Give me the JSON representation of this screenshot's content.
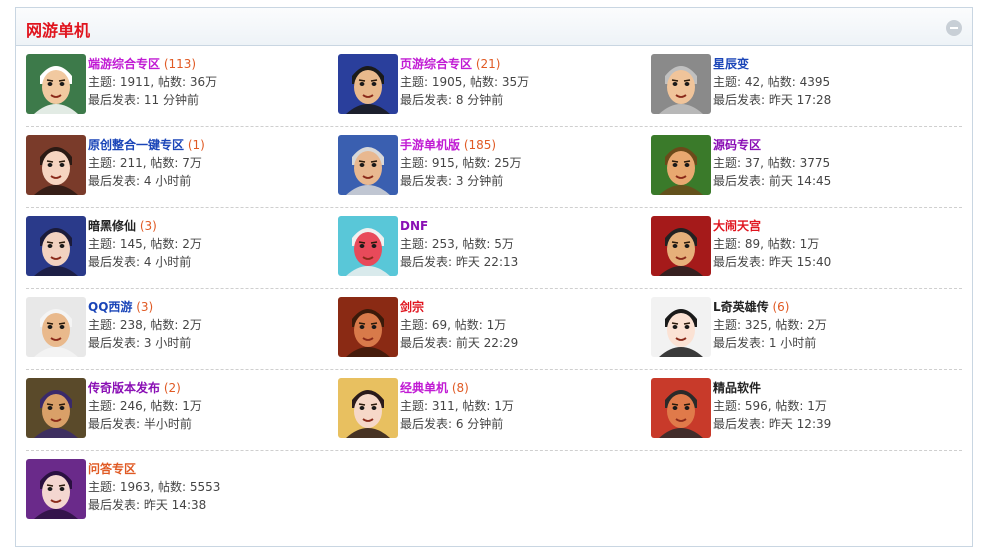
{
  "panel": {
    "title": "网游单机"
  },
  "labels": {
    "topics": "主题",
    "posts": "帖数",
    "last_post": "最后发表"
  },
  "forums": [
    {
      "name": "端游综合专区",
      "count": "(113)",
      "stats": "主题: 1911, 帖数: 36万",
      "last": "最后发表: 11 分钟前",
      "name_color": "#c11bd4",
      "avatar": "old-sage-avatar",
      "bg": "#3d7a4a",
      "face": "#f1c9a0",
      "hair": "#ffffff"
    },
    {
      "name": "页游综合专区",
      "count": "(21)",
      "stats": "主题: 1905, 帖数: 35万",
      "last": "最后发表: 8 分钟前",
      "name_color": "#c11bd4",
      "avatar": "warrior-hat-avatar",
      "bg": "#2a3f9c",
      "face": "#e9b98c",
      "hair": "#1a1a1a"
    },
    {
      "name": "星辰变",
      "count": "",
      "stats": "主题: 42, 帖数: 4395",
      "last": "最后发表: 昨天 17:28",
      "name_color": "#1a45b8",
      "avatar": "helmet-warrior-avatar",
      "bg": "#8a8a8a",
      "face": "#f0c49a",
      "hair": "#c0c0c0"
    },
    {
      "name": "原创整合一键专区",
      "count": "(1)",
      "stats": "主题: 211, 帖数: 7万",
      "last": "最后发表: 4 小时前",
      "name_color": "#1a45b8",
      "avatar": "princess-avatar",
      "bg": "#7a3b2a",
      "face": "#f6d5c1",
      "hair": "#2a1a14"
    },
    {
      "name": "手游单机版",
      "count": "(185)",
      "stats": "主题: 915, 帖数: 25万",
      "last": "最后发表: 3 分钟前",
      "name_color": "#c11bd4",
      "avatar": "granny-avatar",
      "bg": "#3a5fb0",
      "face": "#e8b890",
      "hair": "#d8d8d8"
    },
    {
      "name": "源码专区",
      "count": "",
      "stats": "主题: 37, 帖数: 3775",
      "last": "最后发表: 前天 14:45",
      "name_color": "#8a0fb5",
      "avatar": "monkey-king-avatar",
      "bg": "#3a7a2a",
      "face": "#e8a870",
      "hair": "#6b4a1a"
    },
    {
      "name": "暗黑修仙",
      "count": "(3)",
      "stats": "主题: 145, 帖数: 2万",
      "last": "最后发表: 4 小时前",
      "name_color": "#222222",
      "avatar": "dark-fairy-avatar",
      "bg": "#2a3a8a",
      "face": "#f2d2c0",
      "hair": "#1b1b3a"
    },
    {
      "name": "DNF",
      "count": "",
      "stats": "主题: 253, 帖数: 5万",
      "last": "最后发表: 昨天 22:13",
      "name_color": "#8a0fb5",
      "avatar": "masked-ninja-avatar",
      "bg": "#59c7d8",
      "face": "#e84a5a",
      "hair": "#f0f0f0"
    },
    {
      "name": "大闹天宫",
      "count": "",
      "stats": "主题: 89, 帖数: 1万",
      "last": "最后发表: 昨天 15:40",
      "name_color": "#e0141e",
      "avatar": "horned-demon-avatar",
      "bg": "#a51a1a",
      "face": "#e6b07a",
      "hair": "#222222"
    },
    {
      "name": "QQ西游",
      "count": "(3)",
      "stats": "主题: 238, 帖数: 2万",
      "last": "最后发表: 3 小时前",
      "name_color": "#1a45b8",
      "avatar": "old-master-avatar",
      "bg": "#e8e8e8",
      "face": "#e9b98c",
      "hair": "#f4f4f4"
    },
    {
      "name": "剑宗",
      "count": "",
      "stats": "主题: 69, 帖数: 1万",
      "last": "最后发表: 前天 22:29",
      "name_color": "#e0141e",
      "avatar": "bald-brute-avatar",
      "bg": "#8a2a14",
      "face": "#d87a4a",
      "hair": "#3a1a0a"
    },
    {
      "name": "L奇英雄传",
      "count": "(6)",
      "stats": "主题: 325, 帖数: 2万",
      "last": "最后发表: 1 小时前",
      "name_color": "#222222",
      "avatar": "opera-lady-avatar",
      "bg": "#f2f2f2",
      "face": "#fbe2d4",
      "hair": "#1a1a1a"
    },
    {
      "name": "传奇版本发布",
      "count": "(2)",
      "stats": "主题: 246, 帖数: 1万",
      "last": "最后发表: 半小时前",
      "name_color": "#8a0fb5",
      "avatar": "grinning-villain-avatar",
      "bg": "#5a4a2a",
      "face": "#d9a068",
      "hair": "#3a2a6a"
    },
    {
      "name": "经典单机",
      "count": "(8)",
      "stats": "主题: 311, 帖数: 1万",
      "last": "最后发表: 6 分钟前",
      "name_color": "#c11bd4",
      "avatar": "feathered-girl-avatar",
      "bg": "#e8c060",
      "face": "#f6d8c8",
      "hair": "#2a1a1a"
    },
    {
      "name": "精品软件",
      "count": "",
      "stats": "主题: 596, 帖数: 1万",
      "last": "最后发表: 昨天 12:39",
      "name_color": "#222222",
      "avatar": "bearded-monk-avatar",
      "bg": "#c83a2a",
      "face": "#e07a4a",
      "hair": "#2a2a2a"
    },
    {
      "name": "问答专区",
      "count": "",
      "stats": "主题: 1963, 帖数: 5553",
      "last": "最后发表: 昨天 14:38",
      "name_color": "#e05a24",
      "avatar": "purple-sorceress-avatar",
      "bg": "#6a2a8a",
      "face": "#f4d6d0",
      "hair": "#2a1040"
    }
  ]
}
